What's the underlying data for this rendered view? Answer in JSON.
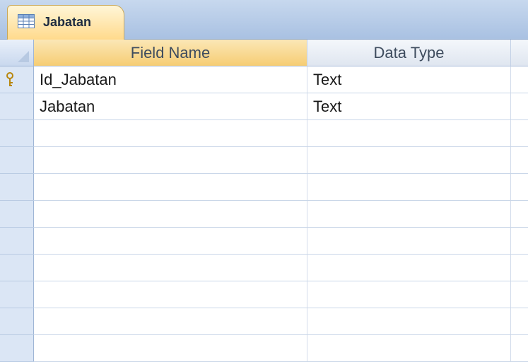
{
  "tab": {
    "label": "Jabatan",
    "icon": "table-icon"
  },
  "columns": {
    "field_name": "Field Name",
    "data_type": "Data Type"
  },
  "rows": [
    {
      "field_name": "Id_Jabatan",
      "data_type": "Text",
      "primary_key": true
    },
    {
      "field_name": "Jabatan",
      "data_type": "Text",
      "primary_key": false
    },
    {
      "field_name": "",
      "data_type": ""
    },
    {
      "field_name": "",
      "data_type": ""
    },
    {
      "field_name": "",
      "data_type": ""
    },
    {
      "field_name": "",
      "data_type": ""
    },
    {
      "field_name": "",
      "data_type": ""
    },
    {
      "field_name": "",
      "data_type": ""
    },
    {
      "field_name": "",
      "data_type": ""
    },
    {
      "field_name": "",
      "data_type": ""
    },
    {
      "field_name": "",
      "data_type": ""
    }
  ],
  "colors": {
    "tab_active": "#ffd98a",
    "header_active": "#f6cd74",
    "selector": "#dbe6f5"
  }
}
